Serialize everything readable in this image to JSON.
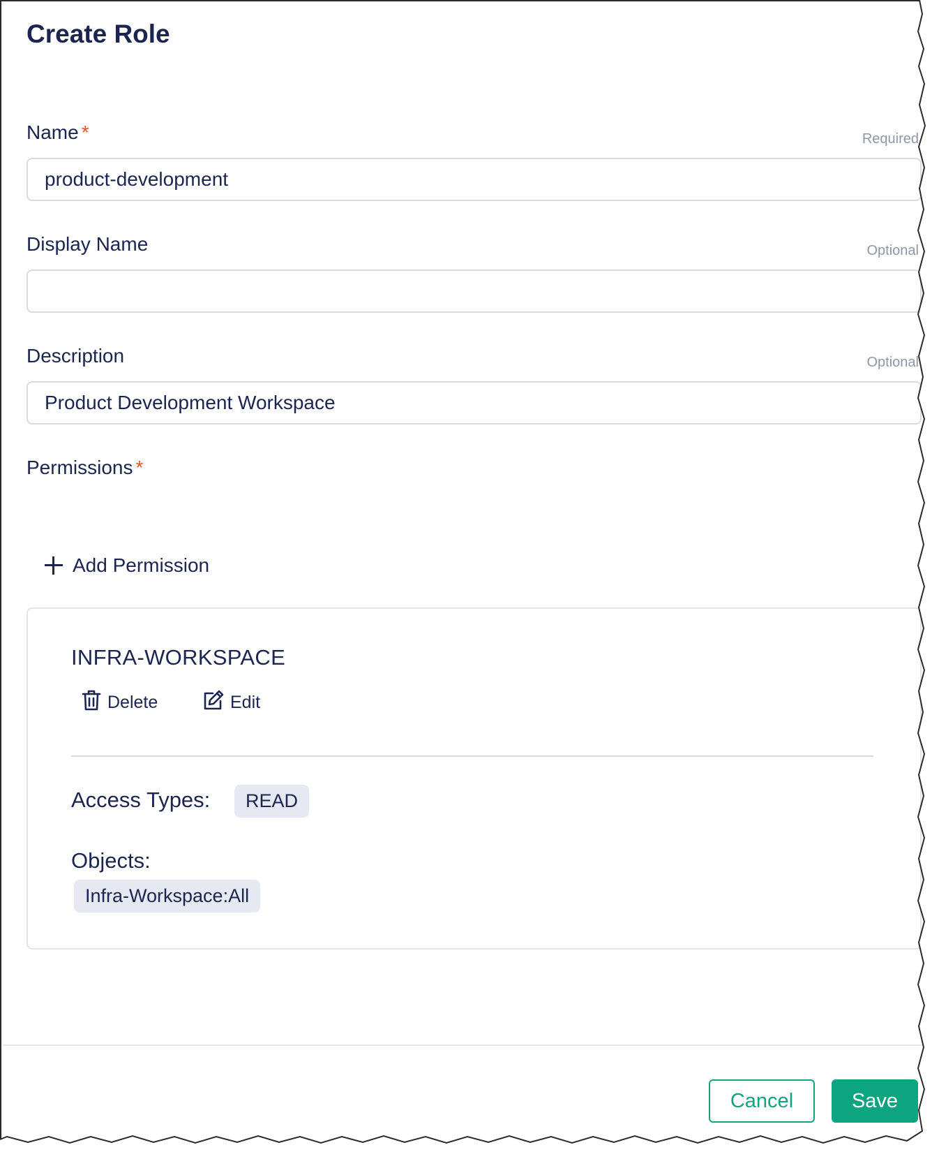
{
  "dialog": {
    "title": "Create Role"
  },
  "form": {
    "name": {
      "label": "Name",
      "required_mark": "*",
      "hint": "Required",
      "value": "product-development",
      "placeholder": ""
    },
    "display_name": {
      "label": "Display Name",
      "hint": "Optional",
      "value": "",
      "placeholder": ""
    },
    "description": {
      "label": "Description",
      "hint": "Optional",
      "value": "Product Development Workspace",
      "placeholder": ""
    },
    "permissions": {
      "label": "Permissions",
      "required_mark": "*",
      "add_label": "Add Permission",
      "items": [
        {
          "name": "INFRA-WORKSPACE",
          "delete_label": "Delete",
          "edit_label": "Edit",
          "access_types_label": "Access Types:",
          "access_types": [
            "READ"
          ],
          "objects_label": "Objects:",
          "objects": [
            "Infra-Workspace:All"
          ]
        }
      ]
    }
  },
  "footer": {
    "cancel_label": "Cancel",
    "save_label": "Save"
  },
  "colors": {
    "text": "#1b2550",
    "required_star": "#e8522e",
    "hint": "#8e96a6",
    "primary": "#0da57f",
    "chip_bg": "#e6e9f2"
  },
  "icons": [
    "plus-icon",
    "trash-icon",
    "edit-icon"
  ]
}
